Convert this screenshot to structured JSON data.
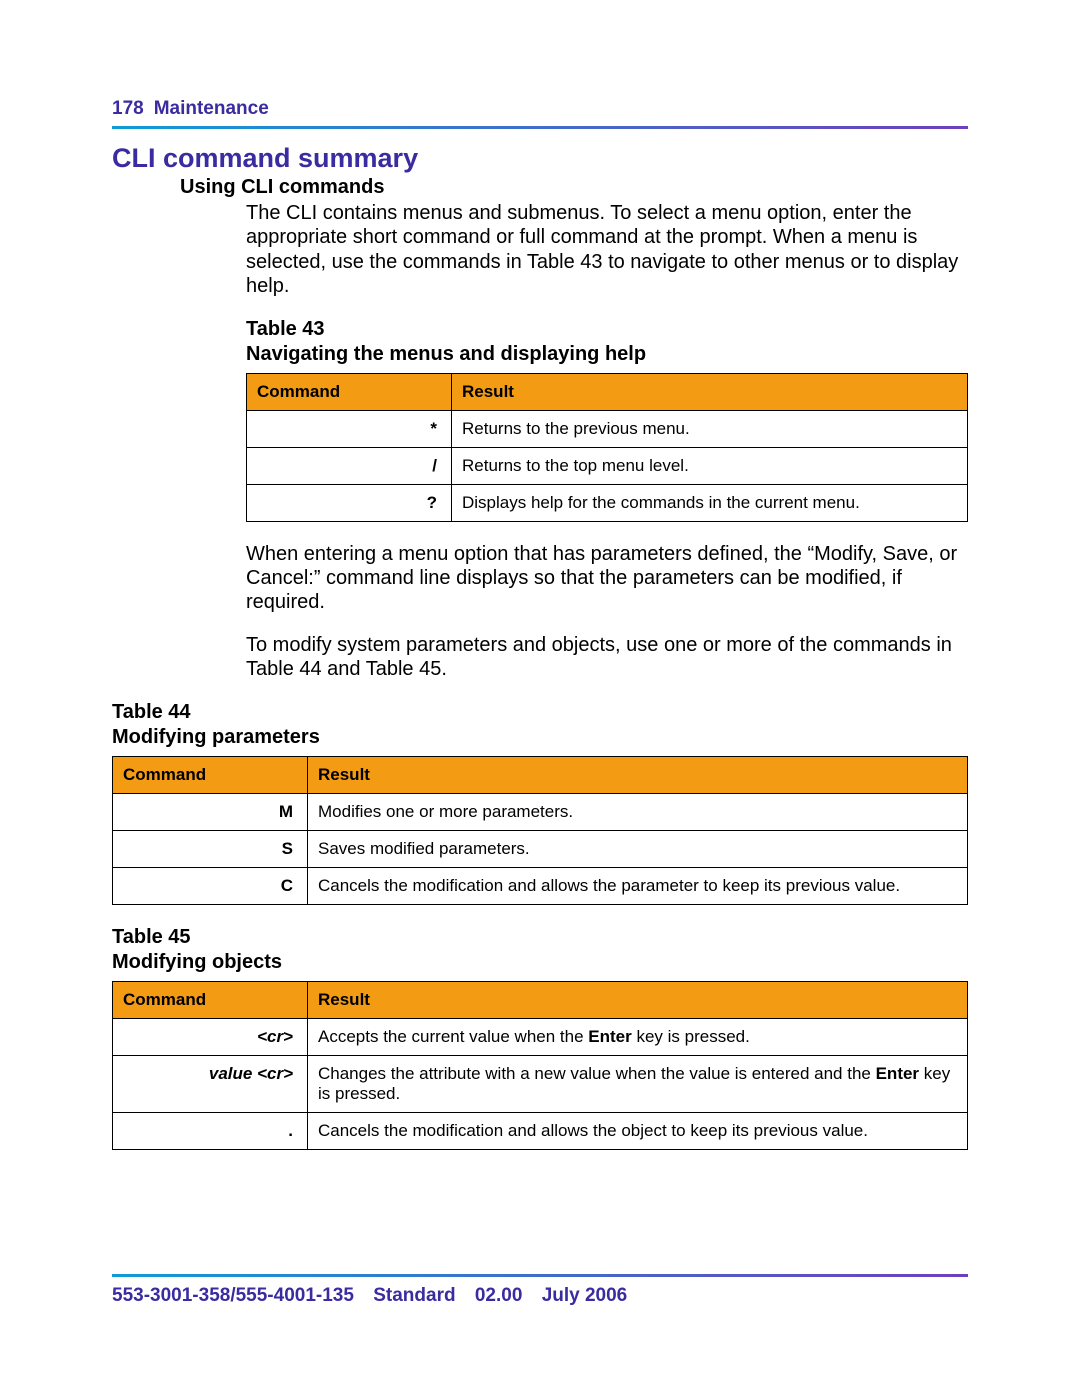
{
  "header": {
    "page_number": "178",
    "section": "Maintenance"
  },
  "title": "CLI command summary",
  "subhead": "Using CLI commands",
  "intro": "The CLI contains menus and submenus. To select a menu option, enter the appropriate short command or full command at the prompt. When a menu is selected, use the commands in Table 43 to navigate to other menus or to display help.",
  "tables": {
    "t43": {
      "number": "Table 43",
      "caption": "Navigating the menus and displaying help",
      "headers": {
        "c1": "Command",
        "c2": "Result"
      },
      "rows": [
        {
          "command": "*",
          "result": "Returns to the previous menu."
        },
        {
          "command": "/",
          "result": "Returns to the top menu level."
        },
        {
          "command": "?",
          "result": "Displays help for the commands in the current menu."
        }
      ]
    },
    "t44": {
      "number": "Table 44",
      "caption": "Modifying parameters",
      "headers": {
        "c1": "Command",
        "c2": "Result"
      },
      "rows": [
        {
          "command": "M",
          "result": "Modifies one or more parameters."
        },
        {
          "command": "S",
          "result": "Saves modified parameters."
        },
        {
          "command": "C",
          "result": "Cancels the modification and allows the parameter to keep its previous value."
        }
      ]
    },
    "t45": {
      "number": "Table 45",
      "caption": "Modifying objects",
      "headers": {
        "c1": "Command",
        "c2": "Result"
      },
      "rows": [
        {
          "command_html": "<span class='ital'>&lt;cr&gt;</span>",
          "result_html": "Accepts the current value when the <b>Enter</b> key is pressed."
        },
        {
          "command_html": "<span class='ital'>value &lt;cr&gt;</span>",
          "result_html": "Changes the attribute with a new value when the value is entered and the <b>Enter</b> key is pressed."
        },
        {
          "command_html": "<b>.</b>",
          "result_html": "Cancels the modification and allows the object to keep its previous value."
        }
      ]
    }
  },
  "mid1": "When entering a menu option that has parameters defined, the “Modify, Save, or Cancel:” command line displays so that the parameters can be modified, if required.",
  "mid2": "To modify system parameters and objects, use one or more of the commands in Table 44 and Table 45.",
  "footer": {
    "docnum": "553-3001-358/555-4001-135",
    "status": "Standard",
    "version": "02.00",
    "date": "July 2006"
  }
}
